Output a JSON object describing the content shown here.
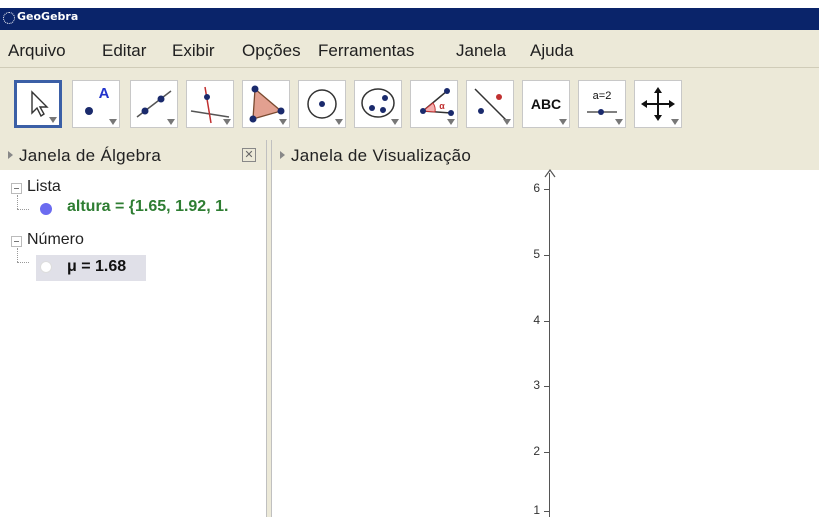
{
  "window": {
    "title": "GeoGebra"
  },
  "menu": [
    "Arquivo",
    "Editar",
    "Exibir",
    "Opções",
    "Ferramentas",
    "Janela",
    "Ajuda"
  ],
  "toolbar": {
    "tools": [
      {
        "name": "move",
        "icon": "arrow-pointer-icon",
        "selected": true
      },
      {
        "name": "point",
        "icon": "point-a-icon",
        "label": "A"
      },
      {
        "name": "line",
        "icon": "line-through-points-icon"
      },
      {
        "name": "perpendicular",
        "icon": "perpendicular-line-icon"
      },
      {
        "name": "polygon",
        "icon": "polygon-icon"
      },
      {
        "name": "circle",
        "icon": "circle-center-point-icon"
      },
      {
        "name": "conic",
        "icon": "ellipse-icon"
      },
      {
        "name": "angle",
        "icon": "angle-icon",
        "label": "α"
      },
      {
        "name": "reflect",
        "icon": "reflect-line-icon"
      },
      {
        "name": "text",
        "icon": "text-icon",
        "label": "ABC"
      },
      {
        "name": "slider",
        "icon": "slider-icon",
        "label": "a=2"
      },
      {
        "name": "move-view",
        "icon": "move-view-icon"
      }
    ]
  },
  "algebra": {
    "header": "Janela de Álgebra",
    "groups": [
      {
        "label": "Lista",
        "items": [
          {
            "text": "altura = {1.65, 1.92, 1.",
            "color": "#2e7d32",
            "dot_color": "#6b6bf0"
          }
        ]
      },
      {
        "label": "Número",
        "items": [
          {
            "text": "μ = 1.68",
            "color": "#111111",
            "dot_color": "#ffffff"
          }
        ]
      }
    ]
  },
  "graphics": {
    "header": "Janela de Visualização",
    "y_ticks": [
      "6",
      "5",
      "4",
      "3",
      "2",
      "1"
    ]
  },
  "colors": {
    "titlebar": "#0a246a",
    "chrome": "#ece9d8",
    "selected_tool_border": "#3b5fa6",
    "selected_row": "#e0e0e8"
  }
}
